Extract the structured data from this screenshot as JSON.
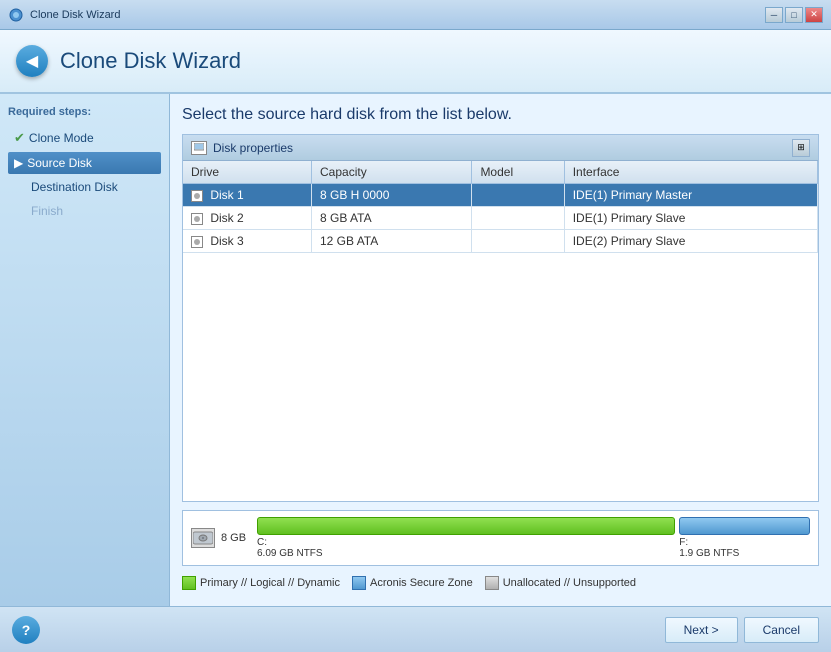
{
  "window": {
    "title": "Clone Disk Wizard"
  },
  "header": {
    "title": "Clone Disk Wizard",
    "back_icon": "◀"
  },
  "sidebar": {
    "required_label": "Required steps:",
    "items": [
      {
        "id": "clone-mode",
        "label": "Clone Mode",
        "has_check": true,
        "state": "done"
      },
      {
        "id": "source-disk",
        "label": "Source Disk",
        "has_arrow": true,
        "state": "active"
      },
      {
        "id": "destination-disk",
        "label": "Destination Disk",
        "state": "normal"
      },
      {
        "id": "finish",
        "label": "Finish",
        "state": "disabled"
      }
    ]
  },
  "content": {
    "title": "Select the source hard disk from the list below.",
    "panel_title": "Disk properties",
    "table": {
      "columns": [
        "Drive",
        "Capacity",
        "Model",
        "Interface"
      ],
      "rows": [
        {
          "drive": "Disk 1",
          "capacity": "8 GB H 0000",
          "model": "",
          "interface": "IDE(1) Primary Master",
          "selected": true
        },
        {
          "drive": "Disk 2",
          "capacity": "8 GB ATA",
          "model": "",
          "interface": "IDE(1) Primary Slave",
          "selected": false
        },
        {
          "drive": "Disk 3",
          "capacity": "12 GB ATA",
          "model": "",
          "interface": "IDE(2) Primary Slave",
          "selected": false
        }
      ]
    }
  },
  "disk_viz": {
    "size_label": "8 GB",
    "partitions": [
      {
        "name": "C:",
        "size_label": "6.09 GB  NTFS",
        "type": "green"
      },
      {
        "name": "F:",
        "size_label": "1.9 GB  NTFS",
        "type": "blue"
      }
    ]
  },
  "legend": {
    "items": [
      {
        "label": "Primary // Logical // Dynamic",
        "color": "green"
      },
      {
        "label": "Acronis Secure Zone",
        "color": "blue"
      },
      {
        "label": "Unallocated // Unsupported",
        "color": "gray"
      }
    ]
  },
  "footer": {
    "help_icon": "?",
    "next_label": "Next >",
    "cancel_label": "Cancel"
  }
}
